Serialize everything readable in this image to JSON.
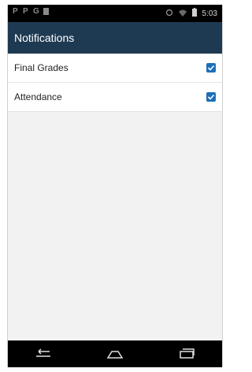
{
  "statusbar": {
    "time": "5:03",
    "left_icons": [
      "p-notification-icon",
      "p-notification-icon",
      "g-notification-icon",
      "square-notification-icon"
    ],
    "right_icons": [
      "alarm-icon",
      "wifi-icon",
      "battery-icon"
    ]
  },
  "appbar": {
    "title": "Notifications",
    "background": "#1e3a52"
  },
  "settings": [
    {
      "label": "Final Grades",
      "checked": true
    },
    {
      "label": "Attendance",
      "checked": true
    }
  ],
  "navbar": {
    "buttons": [
      "back-icon",
      "home-icon",
      "recents-icon"
    ]
  },
  "colors": {
    "accent": "#1e6fb8",
    "statusbar": "#000000",
    "background": "#f2f2f2"
  }
}
